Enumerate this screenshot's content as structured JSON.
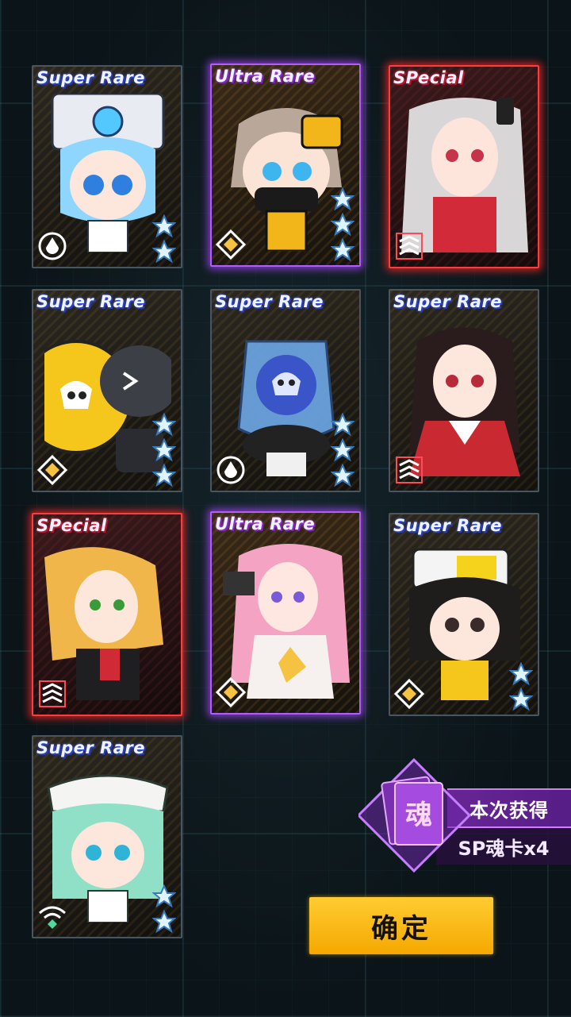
{
  "cards": [
    {
      "rarity": "Super Rare",
      "character": "blue-hair-robot-helmet-chibi",
      "stars": 2,
      "role_icon": "drop-icon"
    },
    {
      "rarity": "Ultra Rare",
      "character": "masked-girl-yellow-armor-chibi",
      "stars": 3,
      "role_icon": "diamond-icon"
    },
    {
      "rarity": "SPecial",
      "character": "silver-hair-girl-headphones",
      "stars": 0,
      "role_icon": "stripes-icon"
    },
    {
      "rarity": "Super Rare",
      "character": "yellow-skull-orb-creature",
      "stars": 3,
      "role_icon": "diamond-icon"
    },
    {
      "rarity": "Super Rare",
      "character": "skull-jar-creature",
      "stars": 3,
      "role_icon": "drop-icon"
    },
    {
      "rarity": "Super Rare",
      "character": "black-hair-kimono-girl",
      "stars": 0,
      "role_icon": "stripes-icon"
    },
    {
      "rarity": "SPecial",
      "character": "blonde-ponytail-girl",
      "stars": 0,
      "role_icon": "stripes-icon"
    },
    {
      "rarity": "Ultra Rare",
      "character": "pink-hair-girl-headset",
      "stars": 0,
      "role_icon": "diamond-icon"
    },
    {
      "rarity": "Super Rare",
      "character": "black-hair-yellow-hat-chibi",
      "stars": 2,
      "role_icon": "diamond-icon"
    },
    {
      "rarity": "Super Rare",
      "character": "green-hair-white-hat-chibi",
      "stars": 2,
      "role_icon": "wifi-icon"
    }
  ],
  "reward": {
    "badge_char": "魂",
    "label": "本次获得",
    "count": "SP魂卡x4"
  },
  "confirm_label": "确定",
  "colors": {
    "accent": "#f5a800",
    "ultra": "#b25cff",
    "special": "#ff3c3c",
    "super": "#3a5dff"
  }
}
